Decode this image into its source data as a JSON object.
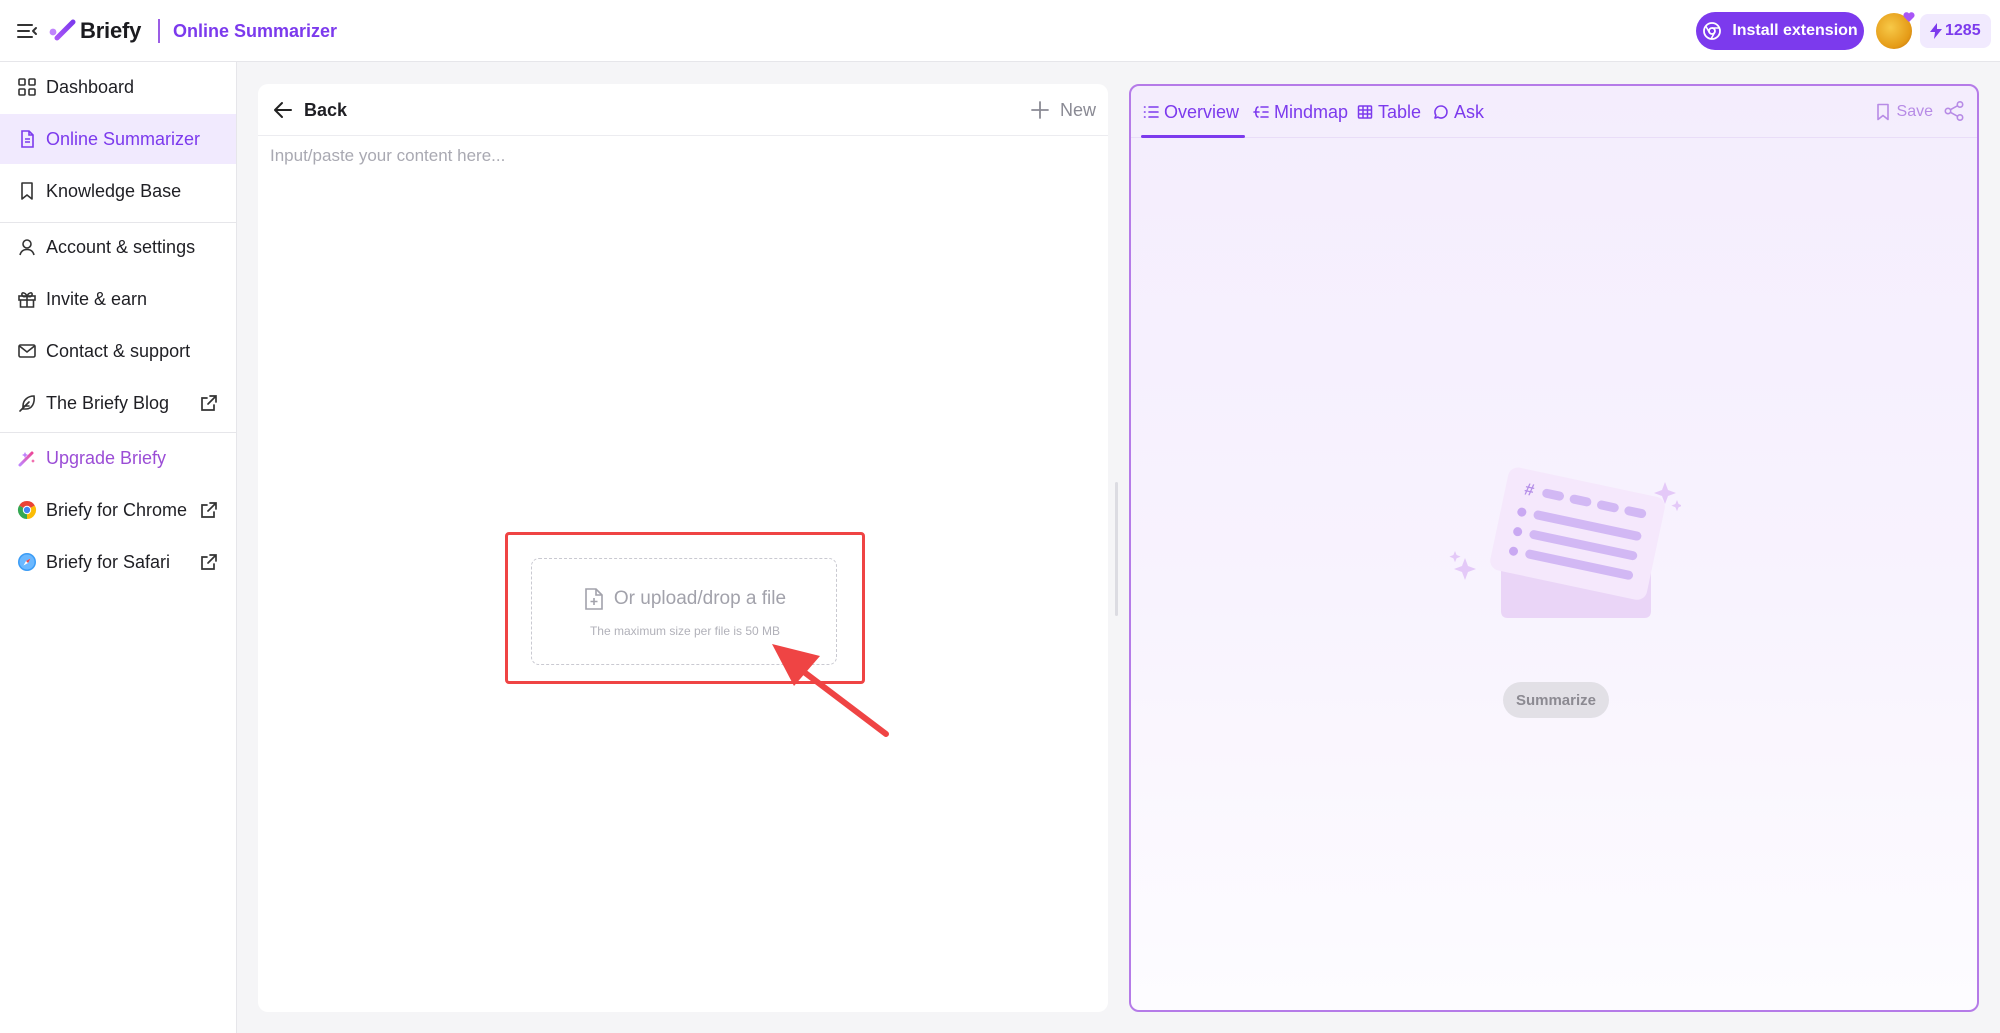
{
  "header": {
    "brand": "Briefy",
    "page_tag": "Online Summarizer",
    "install_label": "Install extension",
    "credits": "1285"
  },
  "sidebar": {
    "items": [
      {
        "label": "Dashboard",
        "icon": "grid-icon"
      },
      {
        "label": "Online Summarizer",
        "icon": "document-icon",
        "active": true
      },
      {
        "label": "Knowledge Base",
        "icon": "bookmark-icon"
      },
      {
        "label": "Account & settings",
        "icon": "user-icon"
      },
      {
        "label": "Invite & earn",
        "icon": "gift-icon"
      },
      {
        "label": "Contact & support",
        "icon": "mail-icon"
      },
      {
        "label": "The Briefy Blog",
        "icon": "feather-icon",
        "external": true
      },
      {
        "label": "Upgrade Briefy",
        "icon": "sparkle-wand-icon"
      },
      {
        "label": "Briefy for Chrome",
        "icon": "chrome-icon",
        "external": true
      },
      {
        "label": "Briefy for Safari",
        "icon": "safari-icon",
        "external": true
      }
    ]
  },
  "editor": {
    "back_label": "Back",
    "new_label": "New",
    "placeholder": "Input/paste your content here...",
    "upload_title": "Or upload/drop a file",
    "upload_sub": "The maximum size per file is 50 MB"
  },
  "result": {
    "tabs": [
      {
        "label": "Overview",
        "icon": "list-icon",
        "active": true
      },
      {
        "label": "Mindmap",
        "icon": "mindmap-icon"
      },
      {
        "label": "Table",
        "icon": "table-icon"
      },
      {
        "label": "Ask",
        "icon": "chat-bubble-icon"
      }
    ],
    "save_label": "Save",
    "summarize_label": "Summarize"
  },
  "colors": {
    "accent": "#7c3aed",
    "annotation": "#ef4444",
    "result_border": "#b57be8"
  }
}
